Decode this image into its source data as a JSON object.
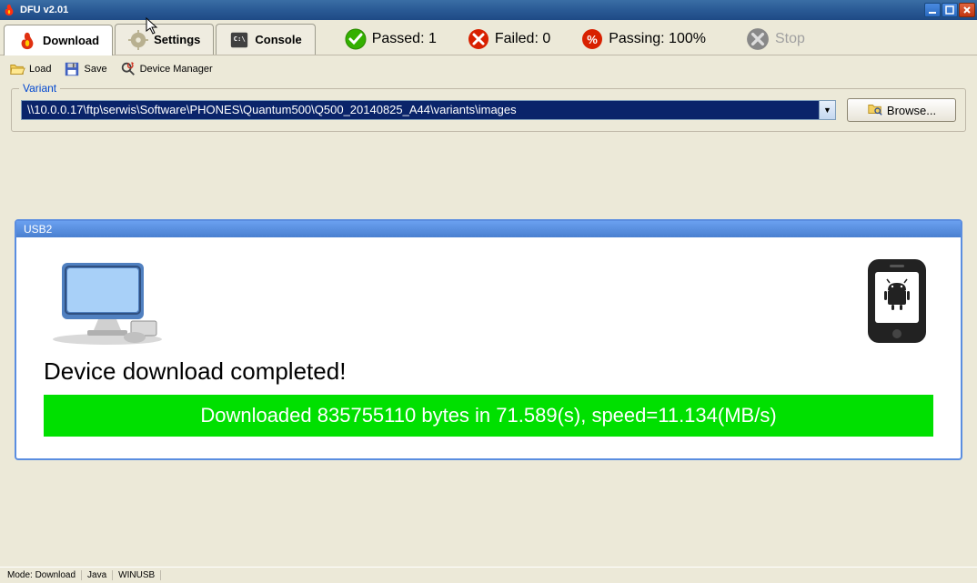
{
  "window": {
    "title": "DFU v2.01"
  },
  "tabs": {
    "download": "Download",
    "settings": "Settings",
    "console": "Console"
  },
  "status": {
    "passed_label": "Passed: 1",
    "failed_label": "Failed: 0",
    "passing_label": "Passing: 100%",
    "stop_label": "Stop"
  },
  "toolbar": {
    "load": "Load",
    "save": "Save",
    "device_manager": "Device Manager"
  },
  "variant": {
    "group_label": "Variant",
    "path": "\\\\10.0.0.17\\ftp\\serwis\\Software\\PHONES\\Quantum500\\Q500_20140825_A44\\variants\\images",
    "browse_label": "Browse..."
  },
  "usb": {
    "title": "USB2",
    "message": "Device download completed!",
    "progress_text": "Downloaded 835755110 bytes in 71.589(s), speed=11.134(MB/s)"
  },
  "statusbar": {
    "mode": "Mode: Download",
    "java": "Java",
    "driver": "WINUSB"
  }
}
